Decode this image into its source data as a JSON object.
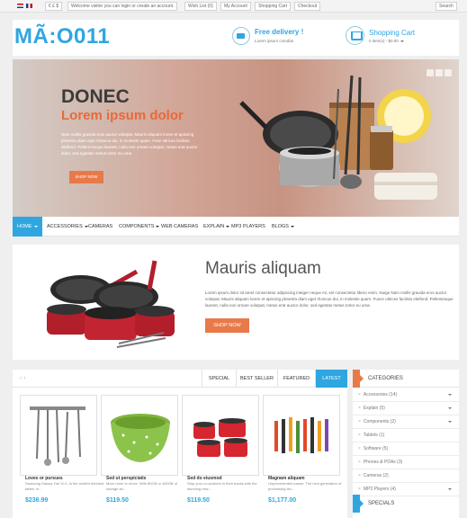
{
  "topbar": {
    "currency": "€ £ $",
    "welcome": "Welcome visitor you can login or create an account.",
    "wishlist": "Wish List (0)",
    "account": "My Account",
    "cart": "Shopping Cart",
    "checkout": "Checkout",
    "search": "Search"
  },
  "header": {
    "logo": "MÃ:O011",
    "delivery_title": "Free delivery !",
    "delivery_sub": "Lorem ipsum conubia",
    "cart_title": "Shopping Cart",
    "cart_sub": "0 item(s) - $0.00"
  },
  "slider": {
    "title": "DONEC",
    "subtitle": "Lorem ipsum dolor",
    "text": "Nam mollis gravida eros auctor volutpat. Mauris aliquam lorem et apiscing pharetra diam eget rhoncus dui, in molestie quam. Fuse ultrices facilisis eleifend. Pellent tesque laoreet, nulla non ornare volutpat, metus erat auctor dolor, sed egestas metus tortor eu uma.",
    "button": "SHOP NOW"
  },
  "nav": {
    "home": "HOME",
    "accessories": "ACCESSORIES",
    "cameras": "CAMERAS",
    "components": "COMPONENTS",
    "webcams": "WEB CAMERAS",
    "explain": "EXPLAIN",
    "mp3": "MP3 PLAYERS",
    "blogs": "BLOGS"
  },
  "banner": {
    "title": "Mauris aliquam",
    "text": "Lorem ipsum dolor sit amet consectetur adipiscing integer neque mi, vel consectetur libero enim. Nuige Nam mollis gravida eros auctor volutpat. Mauris aliquam lorem et apiscing pharetra diam eget rhoncus dui, in molestie quam. Fusce ultrices facilisis eleifend. Pellentesque laoreet, nulla non ornare volutpat, metus erat auctor dolor, sed egestas metus tortor eu uma.",
    "button": "SHOP NOW"
  },
  "tabs": [
    "SPECIAL",
    "BEST SELLER",
    "FEATURED",
    "LATEST"
  ],
  "products": [
    {
      "name": "Loves or pursues",
      "desc": "Samsung Galaxy Tab 10.1, is the world's thinnest tablet, m...",
      "price": "$236.99",
      "icon": "utensils-icon"
    },
    {
      "name": "Sed ut perspiciatis",
      "desc": "More room to move. With 80GB or 160GB of storage an...",
      "price": "$119.50",
      "icon": "bowl-icon"
    },
    {
      "name": "Sed do eiusmod",
      "desc": "Stop your co-workers in their tracks with the stunning new...",
      "price": "$119.50",
      "icon": "pots-icon"
    },
    {
      "name": "Magnam aliquam",
      "desc": "Unprecedented power. The next generation of processing tec...",
      "price": "$1,177.00",
      "icon": "tools-icon"
    }
  ],
  "categories": {
    "title": "CATEGORIES",
    "items": [
      {
        "label": "Accessories (14)",
        "dropdown": true
      },
      {
        "label": "Explain (5)",
        "dropdown": true
      },
      {
        "label": "Components (2)",
        "dropdown": true
      },
      {
        "label": "Tablets (1)",
        "dropdown": false
      },
      {
        "label": "Software (5)",
        "dropdown": false
      },
      {
        "label": "Phones & PDAs (3)",
        "dropdown": false
      },
      {
        "label": "Cameras (2)",
        "dropdown": false
      },
      {
        "label": "MP3 Players (4)",
        "dropdown": true
      }
    ],
    "specials_title": "SPECIALS"
  },
  "colors": {
    "accent_blue": "#2fa6e0",
    "accent_orange": "#e87a49"
  }
}
